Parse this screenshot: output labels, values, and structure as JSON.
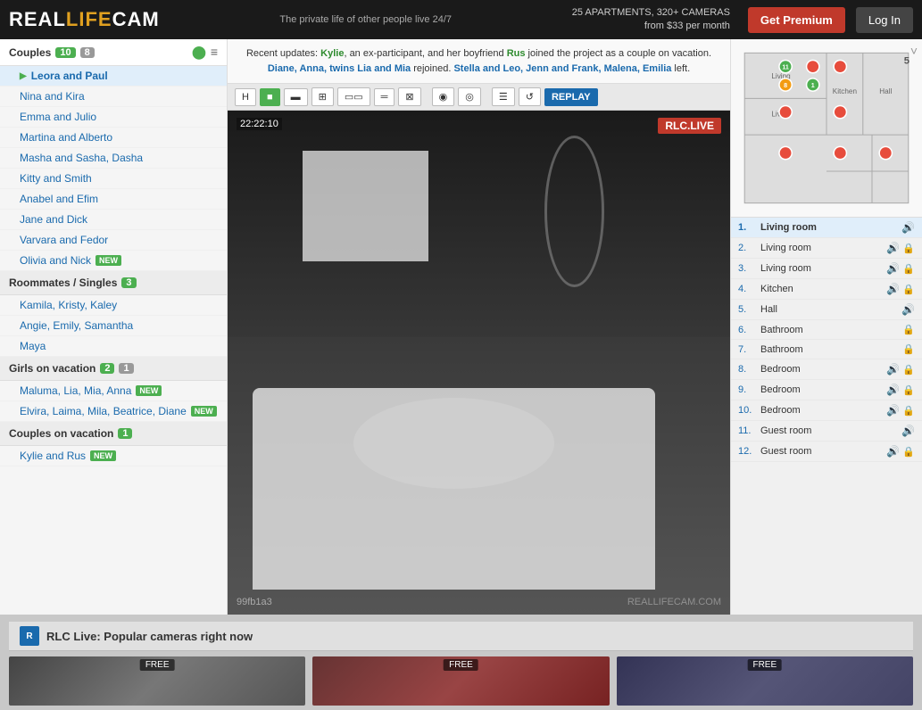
{
  "header": {
    "logo_real": "REAL",
    "logo_life": "LIFE",
    "logo_cam": "CAM",
    "tagline": "The private life of other people live 24/7",
    "stats_line1": "25 APARTMENTS, 320+ CAMERAS",
    "stats_line2": "from $33 per month",
    "btn_premium": "Get Premium",
    "btn_login": "Log In"
  },
  "notification": {
    "text1": "Recent updates: ",
    "name1": "Kylie",
    "text2": ", an ex-participant, and her boyfriend ",
    "name2": "Rus",
    "text3": " joined the project as a couple on vacation. ",
    "names3": "Diane, Anna, twins Lia and Mia",
    "text4": " rejoined. ",
    "names4": "Stella and Leo, Jenn and Frank, Malena, Emilia",
    "text5": " left."
  },
  "sidebar": {
    "couples_label": "Couples",
    "couples_badge_green": "10",
    "couples_badge_gray": "8",
    "items_couples": [
      {
        "label": "Leora and Paul",
        "active": true
      },
      {
        "label": "Nina and Kira"
      },
      {
        "label": "Emma and Julio"
      },
      {
        "label": "Martina and Alberto"
      },
      {
        "label": "Masha and Sasha, Dasha"
      },
      {
        "label": "Kitty and Smith"
      },
      {
        "label": "Anabel and Efim"
      },
      {
        "label": "Jane and Dick"
      },
      {
        "label": "Varvara and Fedor"
      },
      {
        "label": "Olivia and Nick",
        "new": true
      }
    ],
    "roommates_label": "Roommates / Singles",
    "roommates_badge": "3",
    "items_roommates": [
      {
        "label": "Kamila, Kristy, Kaley"
      },
      {
        "label": "Angie, Emily, Samantha"
      },
      {
        "label": "Maya"
      }
    ],
    "girls_label": "Girls on vacation",
    "girls_badge_green": "2",
    "girls_badge_gray": "1",
    "items_girls": [
      {
        "label": "Maluma, Lia, Mia, Anna",
        "new": true
      },
      {
        "label": "Elvira, Laima, Mila, Beatrice, Diane",
        "new": true
      }
    ],
    "couples_vac_label": "Couples on vacation",
    "couples_vac_badge": "1",
    "items_couples_vac": [
      {
        "label": "Kylie and Rus",
        "new": true
      }
    ]
  },
  "toolbar": {
    "buttons": [
      "H",
      "■",
      "▬",
      "⊞",
      "▭▭",
      "═",
      "⊠",
      "◉",
      "◎",
      "☰",
      "↺",
      "REPLAY"
    ]
  },
  "video": {
    "timestamp": "22:22:10",
    "live_label": "RLC.LIVE",
    "video_id": "99fb1a3",
    "watermark": "REALLIFECAM.COM"
  },
  "floorplan": {
    "room_number": "5",
    "chevron": "˅"
  },
  "cameras": [
    {
      "num": "1.",
      "name": "Living room",
      "sound": true,
      "lock": false,
      "active": true
    },
    {
      "num": "2.",
      "name": "Living room",
      "sound": true,
      "lock": true
    },
    {
      "num": "3.",
      "name": "Living room",
      "sound": true,
      "lock": true
    },
    {
      "num": "4.",
      "name": "Kitchen",
      "sound": true,
      "lock": true
    },
    {
      "num": "5.",
      "name": "Hall",
      "sound": true,
      "lock": false
    },
    {
      "num": "6.",
      "name": "Bathroom",
      "sound": false,
      "lock": true
    },
    {
      "num": "7.",
      "name": "Bathroom",
      "sound": false,
      "lock": true
    },
    {
      "num": "8.",
      "name": "Bedroom",
      "sound": true,
      "lock": true
    },
    {
      "num": "9.",
      "name": "Bedroom",
      "sound": true,
      "lock": true
    },
    {
      "num": "10.",
      "name": "Bedroom",
      "sound": true,
      "lock": true
    },
    {
      "num": "11.",
      "name": "Guest room",
      "sound": true,
      "lock": false
    },
    {
      "num": "12.",
      "name": "Guest room",
      "sound": true,
      "lock": true
    }
  ],
  "bottom": {
    "rlc_icon": "R",
    "rlc_title": "RLC Live: Popular cameras right now",
    "thumbs": [
      {
        "type": "default",
        "free": "FREE"
      },
      {
        "type": "r",
        "free": "FREE"
      },
      {
        "type": "b",
        "free": "FREE"
      }
    ]
  }
}
